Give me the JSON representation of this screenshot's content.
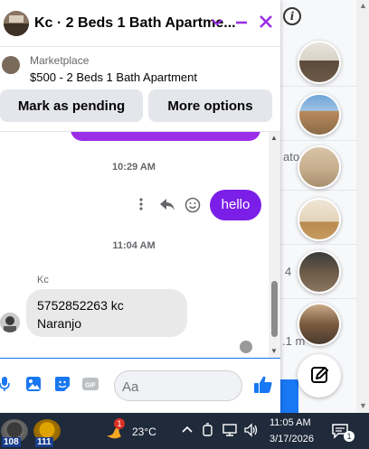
{
  "chat": {
    "title": "Kc · 2 Beds 1 Bath Apartme...",
    "marketplace_label": "Marketplace",
    "listing_title": "$500 - 2 Beds 1 Bath Apartment",
    "mark_pending_label": "Mark as pending",
    "more_options_label": "More options",
    "timestamp_1": "10:29 AM",
    "outgoing_message": "hello",
    "timestamp_2": "11:04 AM",
    "sender_name": "Kc",
    "incoming_message_line1": "5752852263 kc",
    "incoming_message_line2": "Naranjo",
    "composer_placeholder": "Aa"
  },
  "background": {
    "snippet_1": "ato",
    "snippet_2": "4",
    "snippet_3": ".1 m"
  },
  "taskbar": {
    "badge_1": "108",
    "badge_2": "111",
    "weather_badge": "1",
    "temperature": "23°C",
    "time": "11:05 AM",
    "date": "3/17/2026",
    "notification_count": "1"
  },
  "colors": {
    "accent": "#9b2fe8",
    "outgoing_bubble": "#7b1fe8",
    "incoming_bubble": "#e9e9ea",
    "facebook_blue": "#1877f2",
    "taskbar": "#1f2a3a"
  }
}
